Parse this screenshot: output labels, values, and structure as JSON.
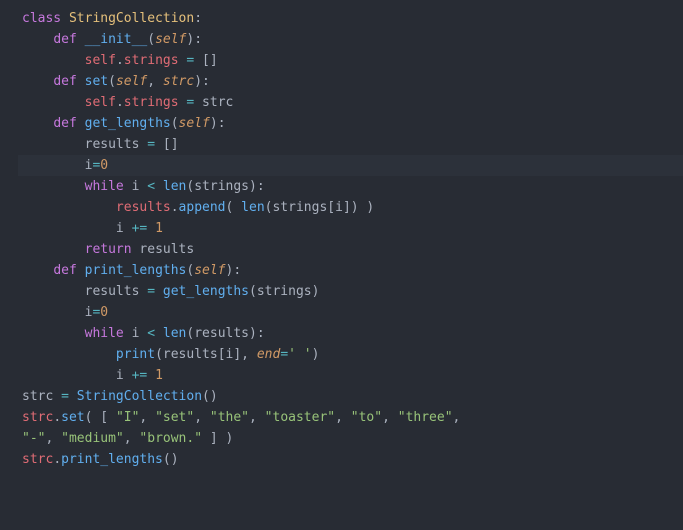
{
  "code": {
    "kw_class": "class",
    "cls_name": "StringCollection",
    "kw_def": "def",
    "fn_init": "__init__",
    "p_self": "self",
    "attr_strings": "strings",
    "eq": "=",
    "fn_set": "set",
    "p_strc": "strc",
    "fn_get_lengths": "get_lengths",
    "v_results": "results",
    "v_i": "i",
    "n_0": "0",
    "kw_while": "while",
    "lt": "<",
    "fn_len": "len",
    "fn_append": "append",
    "pluseq": "+=",
    "n_1": "1",
    "kw_return": "return",
    "fn_print_lengths": "print_lengths",
    "fn_print": "print",
    "p_end": "end",
    "str_space": "' '",
    "v_strc": "strc",
    "str_I": "\"I\"",
    "str_set": "\"set\"",
    "str_the": "\"the\"",
    "str_toaster": "\"toaster\"",
    "str_to": "\"to\"",
    "str_three": "\"three\"",
    "str_dash": "\"-\"",
    "str_medium": "\"medium\"",
    "str_brown": "\"brown.\"",
    "empty_list": "[]",
    "colon": ":",
    "dot": ".",
    "lp": "(",
    "rp": ")",
    "lb": "[",
    "rb": "]",
    "comma": ","
  }
}
